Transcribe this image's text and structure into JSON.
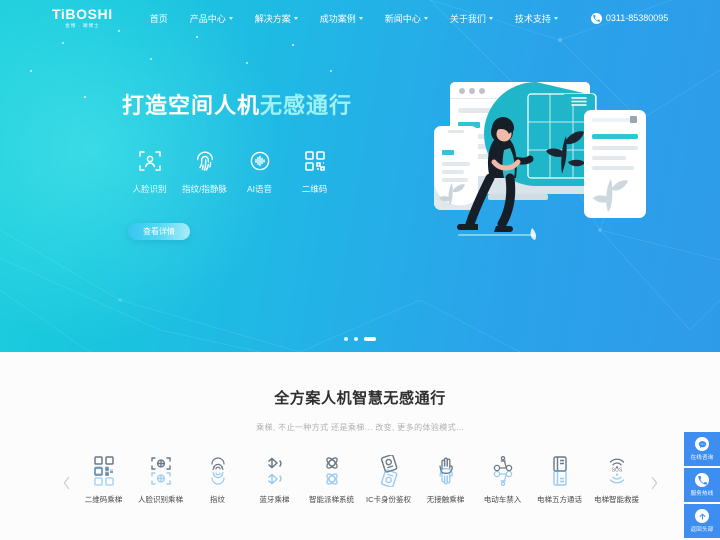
{
  "brand": {
    "logo_main": "TiBOSHI",
    "logo_sub": "金博 · 踢博士"
  },
  "nav": {
    "items": [
      {
        "label": "首页",
        "has_caret": false
      },
      {
        "label": "产品中心",
        "has_caret": true
      },
      {
        "label": "解决方案",
        "has_caret": true
      },
      {
        "label": "成功案例",
        "has_caret": true
      },
      {
        "label": "新闻中心",
        "has_caret": true
      },
      {
        "label": "关于我们",
        "has_caret": true
      },
      {
        "label": "技术支持",
        "has_caret": true
      }
    ],
    "phone": "0311-85380095",
    "phone_icon": "phone-icon"
  },
  "hero": {
    "title_strong": "打造空间人机",
    "title_soft": "无感通行",
    "features": [
      {
        "label": "人脸识别",
        "icon": "face-scan-icon"
      },
      {
        "label": "指纹/指静脉",
        "icon": "fingerprint-icon"
      },
      {
        "label": "AI语音",
        "icon": "voice-wave-icon"
      },
      {
        "label": "二维码",
        "icon": "qr-code-icon"
      }
    ],
    "cta_label": "查看详情",
    "dots": [
      {
        "active": false
      },
      {
        "active": false
      },
      {
        "active": true
      }
    ],
    "illustration": "devices-woman-illustration",
    "colors": {
      "gradient_start": "#1ecfdd",
      "gradient_end": "#2e9be9",
      "soft_text": "#9ff2f4",
      "cta_start": "#36c6ef",
      "cta_end": "#a9ecfa"
    }
  },
  "section": {
    "title": "全方案人机智慧无感通行",
    "subtitle": "乘梯, 不止一种方式 还是乘梯... 改变, 更多的体验模式...",
    "prev_label": "上一页",
    "next_label": "下一页",
    "cards": [
      {
        "label": "二维码乘梯",
        "icon": "qr-code-icon"
      },
      {
        "label": "人脸识别乘梯",
        "icon": "face-scan-icon"
      },
      {
        "label": "指纹",
        "icon": "fingerprint-icon"
      },
      {
        "label": "蓝牙乘梯",
        "icon": "bluetooth-icon"
      },
      {
        "label": "智能派梯系统",
        "icon": "atom-icon"
      },
      {
        "label": "IC卡身份鉴权",
        "icon": "ic-card-icon"
      },
      {
        "label": "无接触乘梯",
        "icon": "hand-icon"
      },
      {
        "label": "电动车禁入",
        "icon": "scooter-icon"
      },
      {
        "label": "电梯五方通话",
        "icon": "intercom-icon"
      },
      {
        "label": "电梯智能救援",
        "icon": "sos-signal-icon"
      }
    ]
  },
  "float_panel": {
    "items": [
      {
        "label": "在线咨询",
        "icon": "chat-icon"
      },
      {
        "label": "服务热线",
        "icon": "phone-icon"
      },
      {
        "label": "返回头部",
        "icon": "arrow-up-icon"
      }
    ],
    "color": "#3d8ef0"
  }
}
